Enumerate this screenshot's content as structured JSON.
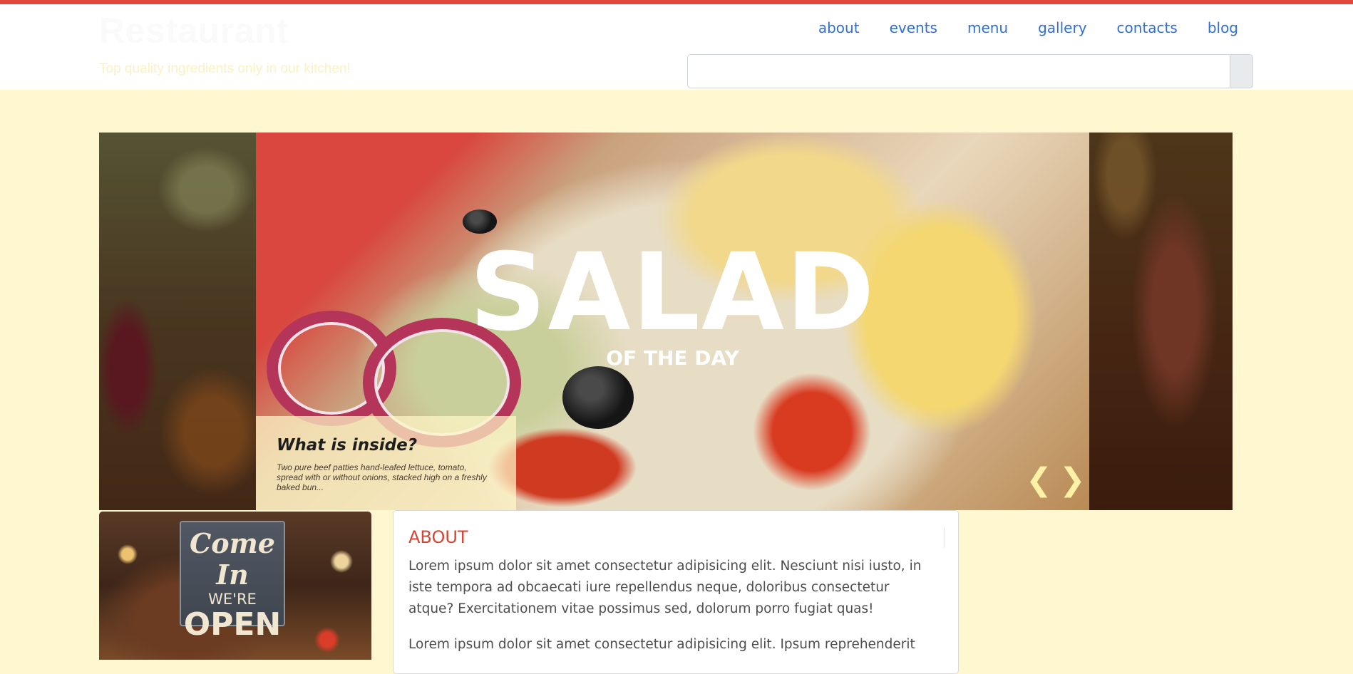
{
  "header": {
    "brand_title": "Restaurant",
    "tagline": "Top quality ingredients only in our kitchen!",
    "nav": [
      "about",
      "events",
      "menu",
      "gallery",
      "contacts",
      "blog"
    ],
    "search": {
      "value": "",
      "placeholder": ""
    }
  },
  "slider": {
    "heading": "SALAD",
    "subheading": "OF THE DAY",
    "caption_title": "What is inside?",
    "caption_text": "Two pure beef patties hand-leafed lettuce, tomato, spread with or without onions, stacked high on a freshly baked bun...",
    "prev_symbol": "❮",
    "next_symbol": "❯"
  },
  "promo_sign": {
    "line1": "Come In",
    "line2": "WE'RE",
    "line3": "OPEN"
  },
  "about": {
    "title": "ABOUT",
    "paragraph1": "Lorem ipsum dolor sit amet consectetur adipisicing elit. Nesciunt nisi iusto, in iste tempora ad obcaecati iure repellendus neque, doloribus consectetur atque? Exercitationem vitae possimus sed, dolorum porro fugiat quas!",
    "paragraph2": "Lorem ipsum dolor sit amet consectetur adipisicing elit. Ipsum reprehenderit"
  },
  "colors": {
    "accent": "#e2483b",
    "page_background": "#fff7cf",
    "nav_link": "#2f6fd6",
    "about_title": "#d84433"
  }
}
